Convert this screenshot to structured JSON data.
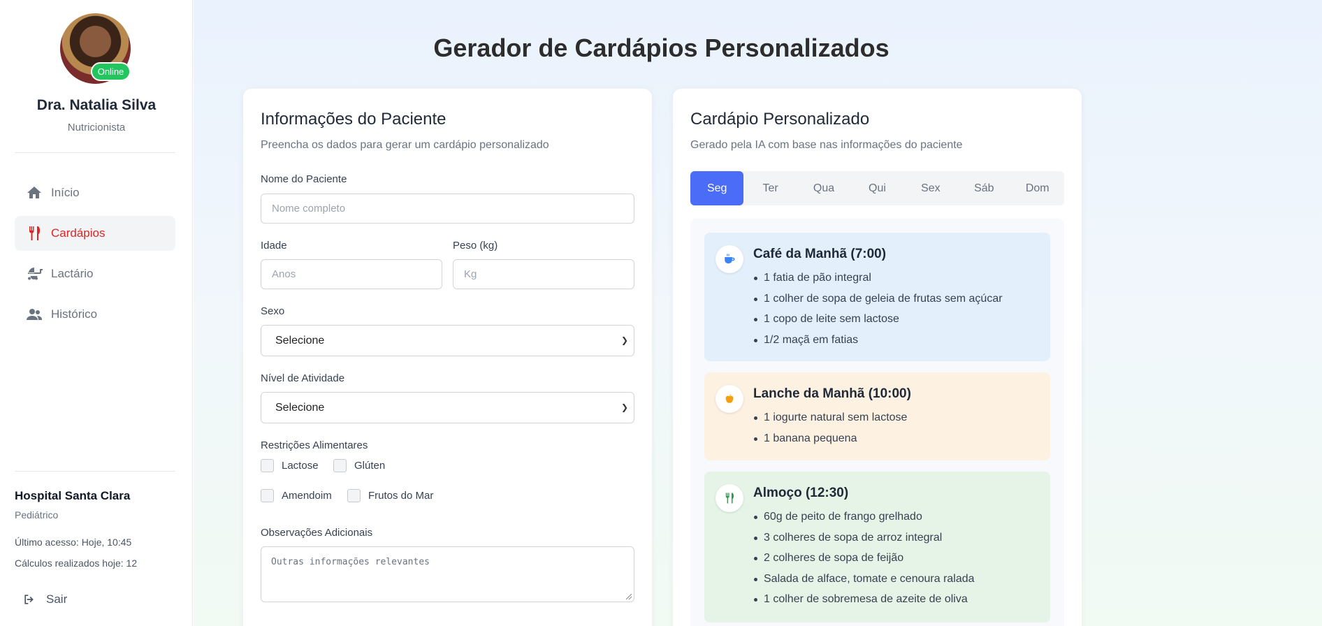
{
  "profile": {
    "name": "Dra. Natalia Silva",
    "role": "Nutricionista",
    "status": "Online"
  },
  "nav": {
    "items": [
      {
        "label": "Início",
        "icon": "home-icon",
        "active": false
      },
      {
        "label": "Cardápios",
        "icon": "utensils-icon",
        "active": true
      },
      {
        "label": "Lactário",
        "icon": "baby-carriage-icon",
        "active": false
      },
      {
        "label": "Histórico",
        "icon": "users-icon",
        "active": false
      }
    ]
  },
  "hospital": {
    "name": "Hospital Santa Clara",
    "department": "Pediátrico",
    "last_access": "Último acesso: Hoje, 10:45",
    "calculations": "Cálculos realizados hoje: 12"
  },
  "logout_label": "Sair",
  "page_title": "Gerador de Cardápios Personalizados",
  "patient_form": {
    "title": "Informações do Paciente",
    "subtitle": "Preencha os dados para gerar um cardápio personalizado",
    "name_label": "Nome do Paciente",
    "name_placeholder": "Nome completo",
    "age_label": "Idade",
    "age_placeholder": "Anos",
    "weight_label": "Peso (kg)",
    "weight_placeholder": "Kg",
    "sex_label": "Sexo",
    "sex_value": "Selecione",
    "activity_label": "Nível de Atividade",
    "activity_value": "Selecione",
    "restrictions_label": "Restrições Alimentares",
    "restrictions": [
      "Lactose",
      "Glúten",
      "Amendoim",
      "Frutos do Mar"
    ],
    "notes_label": "Observações Adicionais",
    "notes_placeholder": "Outras informações relevantes"
  },
  "menu": {
    "title": "Cardápio Personalizado",
    "subtitle": "Gerado pela IA com base nas informações do paciente",
    "days": [
      "Seg",
      "Ter",
      "Qua",
      "Qui",
      "Sex",
      "Sáb",
      "Dom"
    ],
    "active_day": "Seg",
    "meals": [
      {
        "title": "Café da Manhã (7:00)",
        "icon": "coffee-icon",
        "color": "#e3f0fb",
        "items": [
          "1 fatia de pão integral",
          "1 colher de sopa de geleia de frutas sem açúcar",
          "1 copo de leite sem lactose",
          "1/2 maçã em fatias"
        ]
      },
      {
        "title": "Lanche da Manhã (10:00)",
        "icon": "apple-icon",
        "color": "#fdf1e2",
        "items": [
          "1 iogurte natural sem lactose",
          "1 banana pequena"
        ]
      },
      {
        "title": "Almoço (12:30)",
        "icon": "utensils-icon",
        "color": "#e5f4e6",
        "items": [
          "60g de peito de frango grelhado",
          "3 colheres de sopa de arroz integral",
          "2 colheres de sopa de feijão",
          "Salada de alface, tomate e cenoura ralada",
          "1 colher de sobremesa de azeite de oliva"
        ]
      }
    ]
  }
}
